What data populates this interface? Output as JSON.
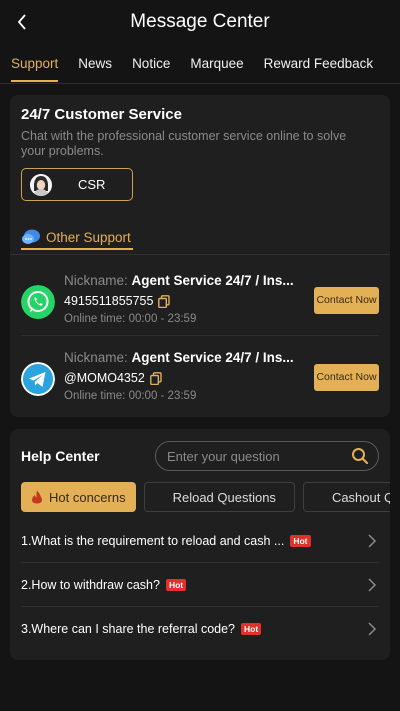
{
  "header": {
    "title": "Message Center",
    "back_icon": "chevron-left-icon"
  },
  "tabs": [
    {
      "label": "Support",
      "active": true
    },
    {
      "label": "News",
      "active": false
    },
    {
      "label": "Notice",
      "active": false
    },
    {
      "label": "Marquee",
      "active": false
    },
    {
      "label": "Reward Feedback",
      "active": false
    }
  ],
  "customer_service": {
    "title": "24/7 Customer Service",
    "description": "Chat with the professional customer service online to solve your problems.",
    "csr_label": "CSR"
  },
  "other_support": {
    "label": "Other Support",
    "agents": [
      {
        "platform": "whatsapp",
        "icon": "whatsapp-icon",
        "nickname_label": "Nickname:",
        "nickname": "Agent Service 24/7 / Ins...",
        "contact": "4915511855755",
        "time_label": "Online time:",
        "time": "00:00 - 23:59",
        "button_label": "Contact Now"
      },
      {
        "platform": "telegram",
        "icon": "telegram-icon",
        "nickname_label": "Nickname:",
        "nickname": "Agent Service 24/7 / Ins...",
        "contact": "@MOMO4352",
        "time_label": "Online time:",
        "time": "00:00 - 23:59",
        "button_label": "Contact Now"
      }
    ]
  },
  "help_center": {
    "title": "Help Center",
    "search_placeholder": "Enter your question",
    "chips": [
      {
        "label": "Hot concerns",
        "active": true,
        "icon": "fire-icon"
      },
      {
        "label": "Reload Questions",
        "active": false
      },
      {
        "label": "Cashout Q",
        "active": false
      }
    ],
    "hot_badge": "Hot",
    "faqs": [
      {
        "text": "1.What is the requirement to reload and cash ...",
        "hot": true
      },
      {
        "text": "2.How to withdraw cash?",
        "hot": true
      },
      {
        "text": "3.Where can I share the referral code?",
        "hot": true
      }
    ]
  },
  "colors": {
    "accent": "#e3b055",
    "background": "#141414",
    "card": "#1f1f1f",
    "hot": "#e0312c",
    "whatsapp": "#25d366",
    "telegram": "#2aa3df"
  }
}
